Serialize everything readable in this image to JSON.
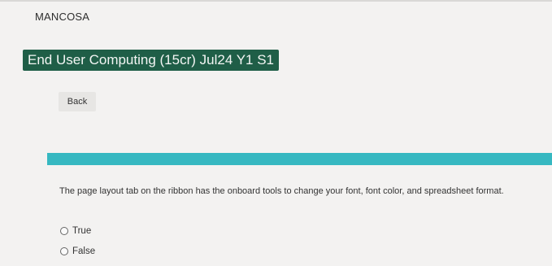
{
  "header": {
    "brand": "MANCOSA",
    "course_title": "End User Computing (15cr) Jul24 Y1 S1"
  },
  "nav": {
    "back_label": "Back"
  },
  "colors": {
    "title_bg": "#1f5e47",
    "progress": "#2fb3bd",
    "background": "#f3f2f1"
  },
  "quiz": {
    "question": "The page layout tab on the ribbon has the onboard tools to change your font, font color, and spreadsheet format.",
    "options": [
      {
        "label": "True",
        "selected": false
      },
      {
        "label": "False",
        "selected": false
      }
    ]
  }
}
